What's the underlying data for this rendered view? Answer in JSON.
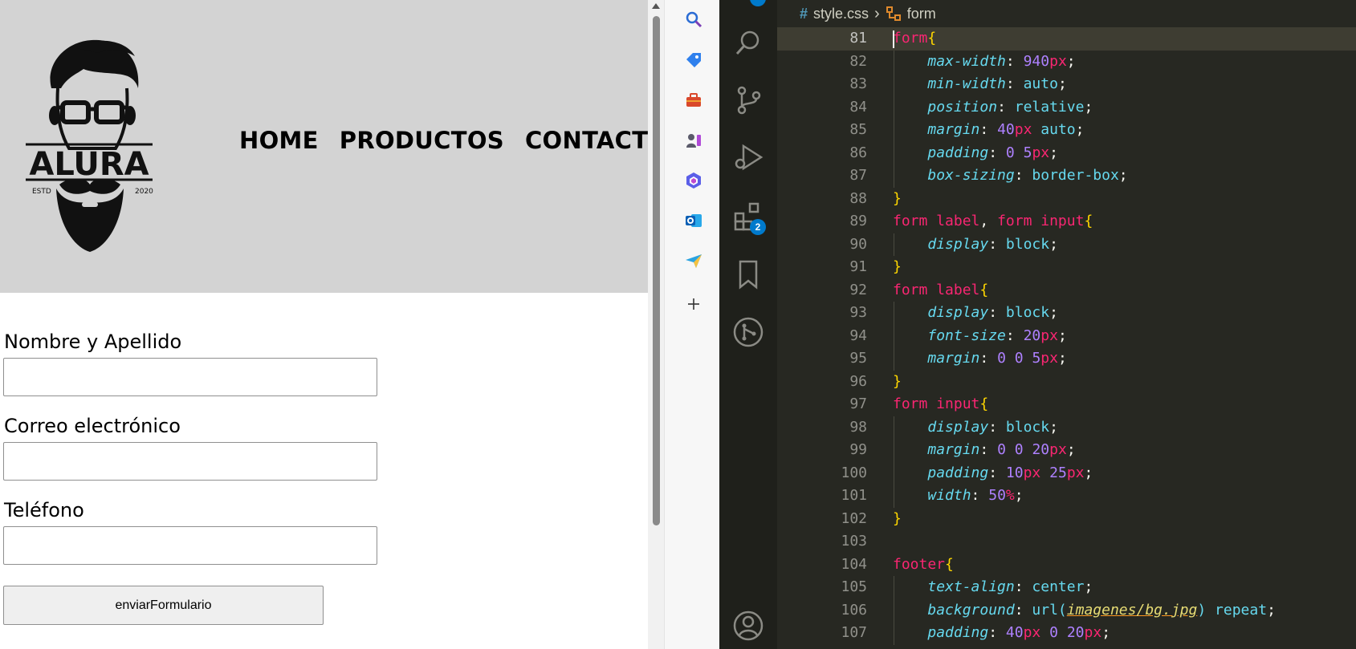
{
  "site": {
    "logo": {
      "text": "ALURA",
      "left_year": "ESTD",
      "right_year": "2020"
    },
    "nav": [
      {
        "label": "HOME"
      },
      {
        "label": "PRODUCTOS"
      },
      {
        "label": "CONTACTO"
      }
    ],
    "form": {
      "fields": [
        {
          "label": "Nombre y Apellido",
          "value": ""
        },
        {
          "label": "Correo electrónico",
          "value": ""
        },
        {
          "label": "Teléfono",
          "value": ""
        }
      ],
      "submit_label": "enviarFormulario"
    }
  },
  "browser_sidebar": {
    "icons": [
      "search-icon",
      "tag-icon",
      "toolbox-icon",
      "games-icon",
      "copilot-icon",
      "outlook-icon",
      "send-icon",
      "add-icon"
    ]
  },
  "editor": {
    "breadcrumb": {
      "file": "style.css",
      "symbol": "form"
    },
    "extensions_badge": "2",
    "active_line": "81",
    "lines": [
      {
        "n": "81",
        "tokens": [
          [
            "sel",
            "form"
          ],
          [
            "brace",
            "{"
          ]
        ]
      },
      {
        "n": "82",
        "tokens": [
          [
            "ind",
            "    "
          ],
          [
            "prop",
            "max-width"
          ],
          [
            "punc",
            ": "
          ],
          [
            "num",
            "940"
          ],
          [
            "unit",
            "px"
          ],
          [
            "punc",
            ";"
          ]
        ]
      },
      {
        "n": "83",
        "tokens": [
          [
            "ind",
            "    "
          ],
          [
            "prop",
            "min-width"
          ],
          [
            "punc",
            ": "
          ],
          [
            "val",
            "auto"
          ],
          [
            "punc",
            ";"
          ]
        ]
      },
      {
        "n": "84",
        "tokens": [
          [
            "ind",
            "    "
          ],
          [
            "prop",
            "position"
          ],
          [
            "punc",
            ": "
          ],
          [
            "val",
            "relative"
          ],
          [
            "punc",
            ";"
          ]
        ]
      },
      {
        "n": "85",
        "tokens": [
          [
            "ind",
            "    "
          ],
          [
            "prop",
            "margin"
          ],
          [
            "punc",
            ": "
          ],
          [
            "num",
            "40"
          ],
          [
            "unit",
            "px"
          ],
          [
            "punc",
            " "
          ],
          [
            "val",
            "auto"
          ],
          [
            "punc",
            ";"
          ]
        ]
      },
      {
        "n": "86",
        "tokens": [
          [
            "ind",
            "    "
          ],
          [
            "prop",
            "padding"
          ],
          [
            "punc",
            ": "
          ],
          [
            "num",
            "0"
          ],
          [
            "punc",
            " "
          ],
          [
            "num",
            "5"
          ],
          [
            "unit",
            "px"
          ],
          [
            "punc",
            ";"
          ]
        ]
      },
      {
        "n": "87",
        "tokens": [
          [
            "ind",
            "    "
          ],
          [
            "prop",
            "box-sizing"
          ],
          [
            "punc",
            ": "
          ],
          [
            "val",
            "border-box"
          ],
          [
            "punc",
            ";"
          ]
        ]
      },
      {
        "n": "88",
        "tokens": [
          [
            "brace",
            "}"
          ]
        ]
      },
      {
        "n": "89",
        "tokens": [
          [
            "sel",
            "form label"
          ],
          [
            "punc",
            ", "
          ],
          [
            "sel",
            "form input"
          ],
          [
            "brace",
            "{"
          ]
        ]
      },
      {
        "n": "90",
        "tokens": [
          [
            "ind",
            "    "
          ],
          [
            "prop",
            "display"
          ],
          [
            "punc",
            ": "
          ],
          [
            "val",
            "block"
          ],
          [
            "punc",
            ";"
          ]
        ]
      },
      {
        "n": "91",
        "tokens": [
          [
            "brace",
            "}"
          ]
        ]
      },
      {
        "n": "92",
        "tokens": [
          [
            "sel",
            "form label"
          ],
          [
            "brace",
            "{"
          ]
        ]
      },
      {
        "n": "93",
        "tokens": [
          [
            "ind",
            "    "
          ],
          [
            "prop",
            "display"
          ],
          [
            "punc",
            ": "
          ],
          [
            "val",
            "block"
          ],
          [
            "punc",
            ";"
          ]
        ]
      },
      {
        "n": "94",
        "tokens": [
          [
            "ind",
            "    "
          ],
          [
            "prop",
            "font-size"
          ],
          [
            "punc",
            ": "
          ],
          [
            "num",
            "20"
          ],
          [
            "unit",
            "px"
          ],
          [
            "punc",
            ";"
          ]
        ]
      },
      {
        "n": "95",
        "tokens": [
          [
            "ind",
            "    "
          ],
          [
            "prop",
            "margin"
          ],
          [
            "punc",
            ": "
          ],
          [
            "num",
            "0"
          ],
          [
            "punc",
            " "
          ],
          [
            "num",
            "0"
          ],
          [
            "punc",
            " "
          ],
          [
            "num",
            "5"
          ],
          [
            "unit",
            "px"
          ],
          [
            "punc",
            ";"
          ]
        ]
      },
      {
        "n": "96",
        "tokens": [
          [
            "brace",
            "}"
          ]
        ]
      },
      {
        "n": "97",
        "tokens": [
          [
            "sel",
            "form input"
          ],
          [
            "brace",
            "{"
          ]
        ]
      },
      {
        "n": "98",
        "tokens": [
          [
            "ind",
            "    "
          ],
          [
            "prop",
            "display"
          ],
          [
            "punc",
            ": "
          ],
          [
            "val",
            "block"
          ],
          [
            "punc",
            ";"
          ]
        ]
      },
      {
        "n": "99",
        "tokens": [
          [
            "ind",
            "    "
          ],
          [
            "prop",
            "margin"
          ],
          [
            "punc",
            ": "
          ],
          [
            "num",
            "0"
          ],
          [
            "punc",
            " "
          ],
          [
            "num",
            "0"
          ],
          [
            "punc",
            " "
          ],
          [
            "num",
            "20"
          ],
          [
            "unit",
            "px"
          ],
          [
            "punc",
            ";"
          ]
        ]
      },
      {
        "n": "100",
        "tokens": [
          [
            "ind",
            "    "
          ],
          [
            "prop",
            "padding"
          ],
          [
            "punc",
            ": "
          ],
          [
            "num",
            "10"
          ],
          [
            "unit",
            "px"
          ],
          [
            "punc",
            " "
          ],
          [
            "num",
            "25"
          ],
          [
            "unit",
            "px"
          ],
          [
            "punc",
            ";"
          ]
        ]
      },
      {
        "n": "101",
        "tokens": [
          [
            "ind",
            "    "
          ],
          [
            "prop",
            "width"
          ],
          [
            "punc",
            ": "
          ],
          [
            "num",
            "50"
          ],
          [
            "unit",
            "%"
          ],
          [
            "punc",
            ";"
          ]
        ]
      },
      {
        "n": "102",
        "tokens": [
          [
            "brace",
            "}"
          ]
        ]
      },
      {
        "n": "103",
        "tokens": []
      },
      {
        "n": "104",
        "tokens": [
          [
            "sel",
            "footer"
          ],
          [
            "brace",
            "{"
          ]
        ]
      },
      {
        "n": "105",
        "tokens": [
          [
            "ind",
            "    "
          ],
          [
            "prop",
            "text-align"
          ],
          [
            "punc",
            ": "
          ],
          [
            "val",
            "center"
          ],
          [
            "punc",
            ";"
          ]
        ]
      },
      {
        "n": "106",
        "tokens": [
          [
            "ind",
            "    "
          ],
          [
            "prop",
            "background"
          ],
          [
            "punc",
            ": "
          ],
          [
            "val",
            "url("
          ],
          [
            "str",
            "imagenes/bg.jpg"
          ],
          [
            "val",
            ")"
          ],
          [
            "punc",
            " "
          ],
          [
            "val",
            "repeat"
          ],
          [
            "punc",
            ";"
          ]
        ]
      },
      {
        "n": "107",
        "tokens": [
          [
            "ind",
            "    "
          ],
          [
            "prop",
            "padding"
          ],
          [
            "punc",
            ": "
          ],
          [
            "num",
            "40"
          ],
          [
            "unit",
            "px"
          ],
          [
            "punc",
            " "
          ],
          [
            "num",
            "0"
          ],
          [
            "punc",
            " "
          ],
          [
            "num",
            "20"
          ],
          [
            "unit",
            "px"
          ],
          [
            "punc",
            ";"
          ]
        ]
      }
    ]
  },
  "colors": {
    "editor_bg": "#272822",
    "header_bg": "#d3d3d3",
    "accent": "#007acc"
  }
}
